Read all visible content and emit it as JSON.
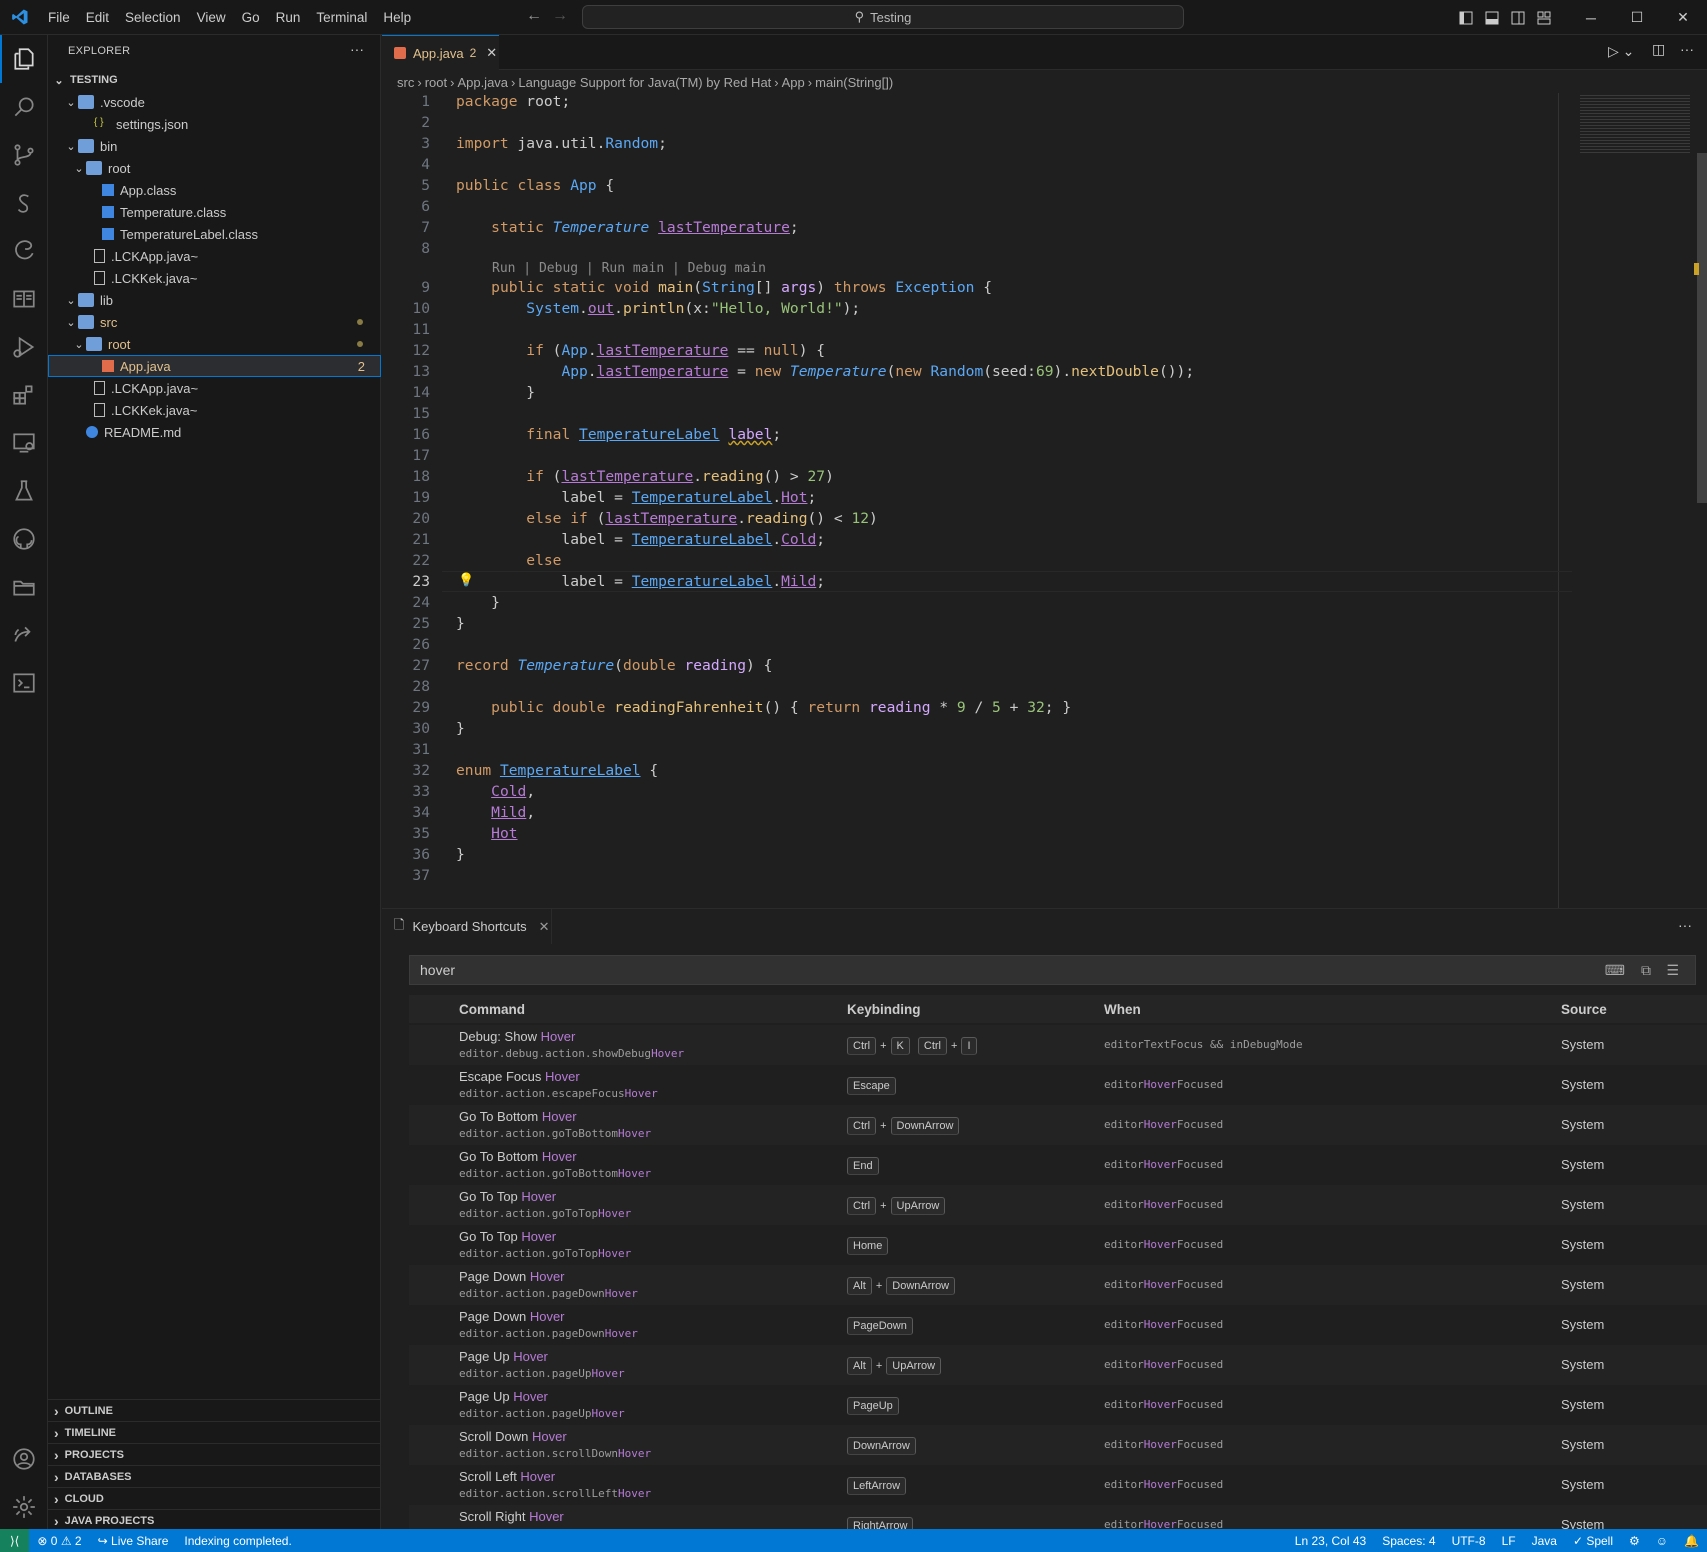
{
  "titlebar": {
    "menu": [
      "File",
      "Edit",
      "Selection",
      "View",
      "Go",
      "Run",
      "Terminal",
      "Help"
    ],
    "search": "Testing"
  },
  "sidebar": {
    "title": "EXPLORER",
    "root": "TESTING",
    "tree": [
      {
        "label": ".vscode",
        "indent": 1,
        "type": "folder",
        "open": true
      },
      {
        "label": "settings.json",
        "indent": 3,
        "type": "json"
      },
      {
        "label": "bin",
        "indent": 1,
        "type": "folder",
        "open": true
      },
      {
        "label": "root",
        "indent": 2,
        "type": "folder",
        "open": true
      },
      {
        "label": "App.class",
        "indent": 4,
        "type": "class"
      },
      {
        "label": "Temperature.class",
        "indent": 4,
        "type": "class"
      },
      {
        "label": "TemperatureLabel.class",
        "indent": 4,
        "type": "class"
      },
      {
        "label": ".LCKApp.java~",
        "indent": 3,
        "type": "file"
      },
      {
        "label": ".LCKKek.java~",
        "indent": 3,
        "type": "file"
      },
      {
        "label": "lib",
        "indent": 1,
        "type": "folder",
        "open": true
      },
      {
        "label": "src",
        "indent": 1,
        "type": "folder",
        "open": true,
        "dot": true,
        "color": "#e2c08d"
      },
      {
        "label": "root",
        "indent": 2,
        "type": "folder",
        "open": true,
        "dot": true,
        "color": "#e2c08d"
      },
      {
        "label": "App.java",
        "indent": 4,
        "type": "java",
        "selected": true,
        "badge": "2",
        "color": "#e2c08d"
      },
      {
        "label": ".LCKApp.java~",
        "indent": 3,
        "type": "file"
      },
      {
        "label": ".LCKKek.java~",
        "indent": 3,
        "type": "file"
      },
      {
        "label": "README.md",
        "indent": 2,
        "type": "info"
      }
    ],
    "sections": [
      "OUTLINE",
      "TIMELINE",
      "PROJECTS",
      "DATABASES",
      "CLOUD",
      "JAVA PROJECTS"
    ]
  },
  "editor": {
    "tab_label": "App.java",
    "tab_badge": "2",
    "breadcrumbs": [
      "src",
      "root",
      "App.java",
      "Language Support for Java(TM) by Red Hat",
      "App",
      "main(String[])"
    ],
    "codelens": "Run | Debug | Run main | Debug main",
    "current_line": "23"
  },
  "panel": {
    "tab_label": "Keyboard Shortcuts",
    "search_value": "hover",
    "headers": {
      "command": "Command",
      "keybinding": "Keybinding",
      "when": "When",
      "source": "Source"
    },
    "rows": [
      {
        "cmd": "Debug: Show ",
        "id": "editor.debug.action.showDebug",
        "keys": [
          [
            "Ctrl",
            "K"
          ],
          [
            "Ctrl",
            "I"
          ]
        ],
        "when": "editorTextFocus && inDebugMode",
        "whenhl": false,
        "src": "System"
      },
      {
        "cmd": "Escape Focus ",
        "id": "editor.action.escapeFocus",
        "keys": [
          [
            "Escape"
          ]
        ],
        "when": "Focused",
        "whenhl": true,
        "src": "System"
      },
      {
        "cmd": "Go To Bottom ",
        "id": "editor.action.goToBottom",
        "keys": [
          [
            "Ctrl",
            "DownArrow"
          ]
        ],
        "when": "Focused",
        "whenhl": true,
        "src": "System"
      },
      {
        "cmd": "Go To Bottom ",
        "id": "editor.action.goToBottom",
        "keys": [
          [
            "End"
          ]
        ],
        "when": "Focused",
        "whenhl": true,
        "src": "System"
      },
      {
        "cmd": "Go To Top ",
        "id": "editor.action.goToTop",
        "keys": [
          [
            "Ctrl",
            "UpArrow"
          ]
        ],
        "when": "Focused",
        "whenhl": true,
        "src": "System"
      },
      {
        "cmd": "Go To Top ",
        "id": "editor.action.goToTop",
        "keys": [
          [
            "Home"
          ]
        ],
        "when": "Focused",
        "whenhl": true,
        "src": "System"
      },
      {
        "cmd": "Page Down ",
        "id": "editor.action.pageDown",
        "keys": [
          [
            "Alt",
            "DownArrow"
          ]
        ],
        "when": "Focused",
        "whenhl": true,
        "src": "System"
      },
      {
        "cmd": "Page Down ",
        "id": "editor.action.pageDown",
        "keys": [
          [
            "PageDown"
          ]
        ],
        "when": "Focused",
        "whenhl": true,
        "src": "System"
      },
      {
        "cmd": "Page Up ",
        "id": "editor.action.pageUp",
        "keys": [
          [
            "Alt",
            "UpArrow"
          ]
        ],
        "when": "Focused",
        "whenhl": true,
        "src": "System"
      },
      {
        "cmd": "Page Up ",
        "id": "editor.action.pageUp",
        "keys": [
          [
            "PageUp"
          ]
        ],
        "when": "Focused",
        "whenhl": true,
        "src": "System"
      },
      {
        "cmd": "Scroll Down ",
        "id": "editor.action.scrollDown",
        "keys": [
          [
            "DownArrow"
          ]
        ],
        "when": "Focused",
        "whenhl": true,
        "src": "System"
      },
      {
        "cmd": "Scroll Left ",
        "id": "editor.action.scrollLeft",
        "keys": [
          [
            "LeftArrow"
          ]
        ],
        "when": "Focused",
        "whenhl": true,
        "src": "System"
      },
      {
        "cmd": "Scroll Right ",
        "id": "editor.action.scrollRight",
        "keys": [
          [
            "RightArrow"
          ]
        ],
        "when": "Focused",
        "whenhl": true,
        "src": "System"
      }
    ],
    "hl_word": "Hover",
    "when_prefix": "editor"
  },
  "statusbar": {
    "errors": "0",
    "warnings": "2",
    "liveshare": "Live Share",
    "message": "Indexing completed.",
    "position": "Ln 23, Col 43",
    "spaces": "Spaces: 4",
    "encoding": "UTF-8",
    "eol": "LF",
    "language": "Java",
    "spell": "✓ Spell"
  },
  "colors": {
    "accent": "#0078d4",
    "modified": "#e2c08d",
    "highlight": "#b77bd6"
  }
}
